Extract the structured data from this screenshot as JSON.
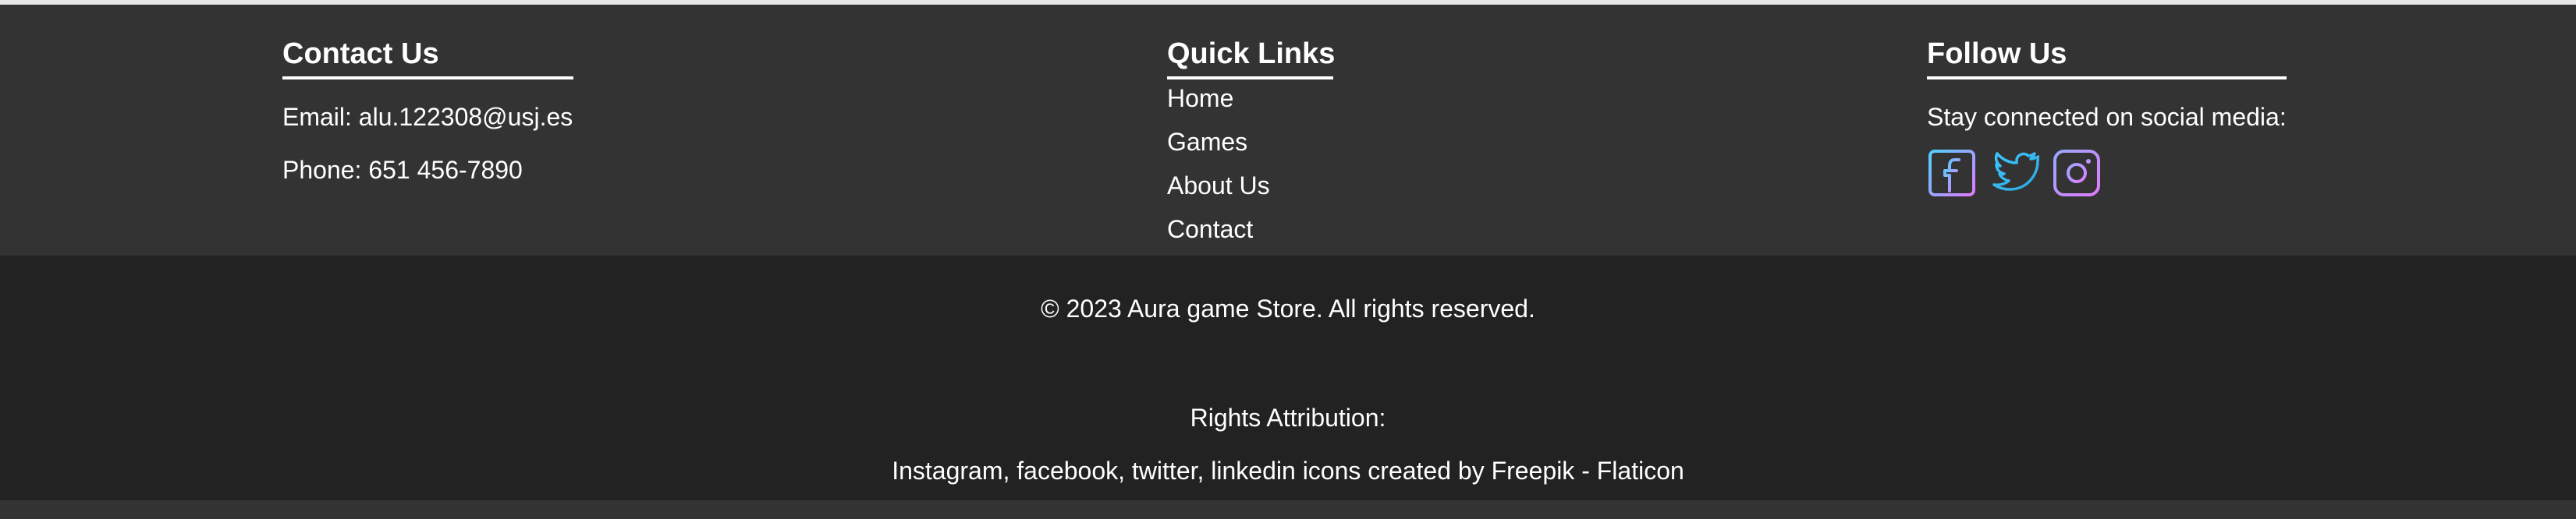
{
  "contact": {
    "heading": "Contact Us",
    "email": "Email: alu.122308@usj.es",
    "phone": "Phone: 651 456-7890"
  },
  "quick_links": {
    "heading": "Quick Links",
    "items": [
      {
        "label": "Home"
      },
      {
        "label": "Games"
      },
      {
        "label": "About Us"
      },
      {
        "label": "Contact"
      }
    ]
  },
  "follow": {
    "heading": "Follow Us",
    "text": "Stay connected on social media:",
    "icons": [
      "facebook-icon",
      "twitter-icon",
      "instagram-icon"
    ]
  },
  "footer": {
    "copyright": "© 2023 Aura game Store. All rights reserved.",
    "attribution_title": "Rights Attribution:",
    "attribution_text": "Instagram, facebook, twitter, linkedin icons created by Freepik - Flaticon"
  },
  "colors": {
    "upper_bg": "#333333",
    "lower_bg": "#222222",
    "icon_gradient_start": "#4fd1ff",
    "icon_gradient_end": "#e07cff"
  }
}
